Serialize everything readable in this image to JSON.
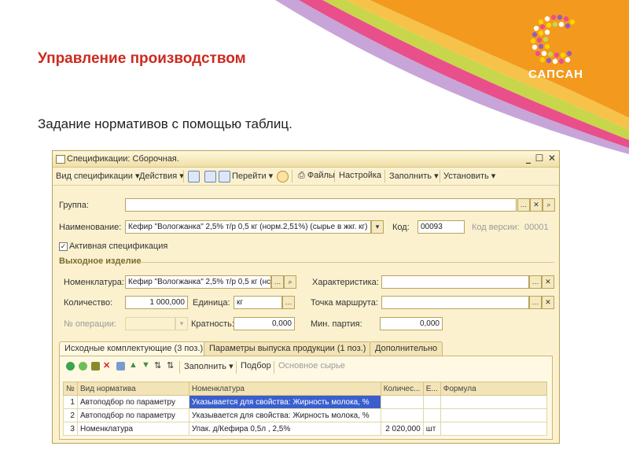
{
  "slide": {
    "title": "Управление производством",
    "subtitle": "Задание нормативов с помощью таблиц.",
    "logo_text": "САПСАН"
  },
  "window": {
    "title": "Спецификации: Сборочная.",
    "controls": {
      "minimize": "_",
      "maximize": "☐",
      "close": "✕"
    }
  },
  "toolbar": {
    "spec_kind": "Вид спецификации",
    "actions": "Действия",
    "goto": "Перейти",
    "files": "Файлы",
    "settings": "Настройка",
    "fill": "Заполнить",
    "set": "Установить"
  },
  "form": {
    "group_label": "Группа:",
    "group_value": "",
    "name_label": "Наименование:",
    "name_value": "Кефир \"Вологжанка\" 2,5% т/р 0,5 кг (норм.2,51%) (сырье в жкг. кг)",
    "code_label": "Код:",
    "code_value": "00093",
    "version_label": "Код версии:",
    "version_value": "00001",
    "active_label": "Активная спецификация",
    "active_checked": true,
    "output_header": "Выходное изделие",
    "nomen_label": "Номенклатура:",
    "nomen_value": "Кефир \"Вологжанка\" 2,5% т/р 0,5 кг (нс",
    "char_label": "Характеристика:",
    "char_value": "",
    "qty_label": "Количество:",
    "qty_value": "1 000,000",
    "unit_label": "Единица:",
    "unit_value": "кг",
    "route_label": "Точка маршрута:",
    "route_value": "",
    "op_label": "№ операции:",
    "op_value": "",
    "mult_label": "Кратность:",
    "mult_value": "0,000",
    "minbatch_label": "Мин. партия:",
    "minbatch_value": "0,000"
  },
  "tabs": [
    {
      "label": "Исходные комплектующие (3 поз.)"
    },
    {
      "label": "Параметры выпуска продукции (1 поз.)"
    },
    {
      "label": "Дополнительно"
    }
  ],
  "panel_toolbar": {
    "fill": "Заполнить",
    "select": "Подбор",
    "basic": "Основное сырье"
  },
  "table": {
    "columns": [
      "№",
      "Вид норматива",
      "Номенклатура",
      "Количес...",
      "Е...",
      "Формула"
    ],
    "rows": [
      {
        "n": "1",
        "kind": "Автоподбор по параметру",
        "nomen": "Указывается для свойства: Жирность молока, %",
        "qty": "",
        "unit": "",
        "formula": ""
      },
      {
        "n": "2",
        "kind": "Автоподбор по параметру",
        "nomen": "Указывается для свойства: Жирность молока, %",
        "qty": "",
        "unit": "",
        "formula": ""
      },
      {
        "n": "3",
        "kind": "Номенклатура",
        "nomen": "Упак. д/Кефира 0,5л , 2,5%",
        "qty": "2 020,000",
        "unit": "шт",
        "formula": ""
      }
    ]
  },
  "colors": {
    "title_red": "#cc2a1f",
    "orange": "#f39a1e",
    "highlight": "#3a5fcd"
  }
}
